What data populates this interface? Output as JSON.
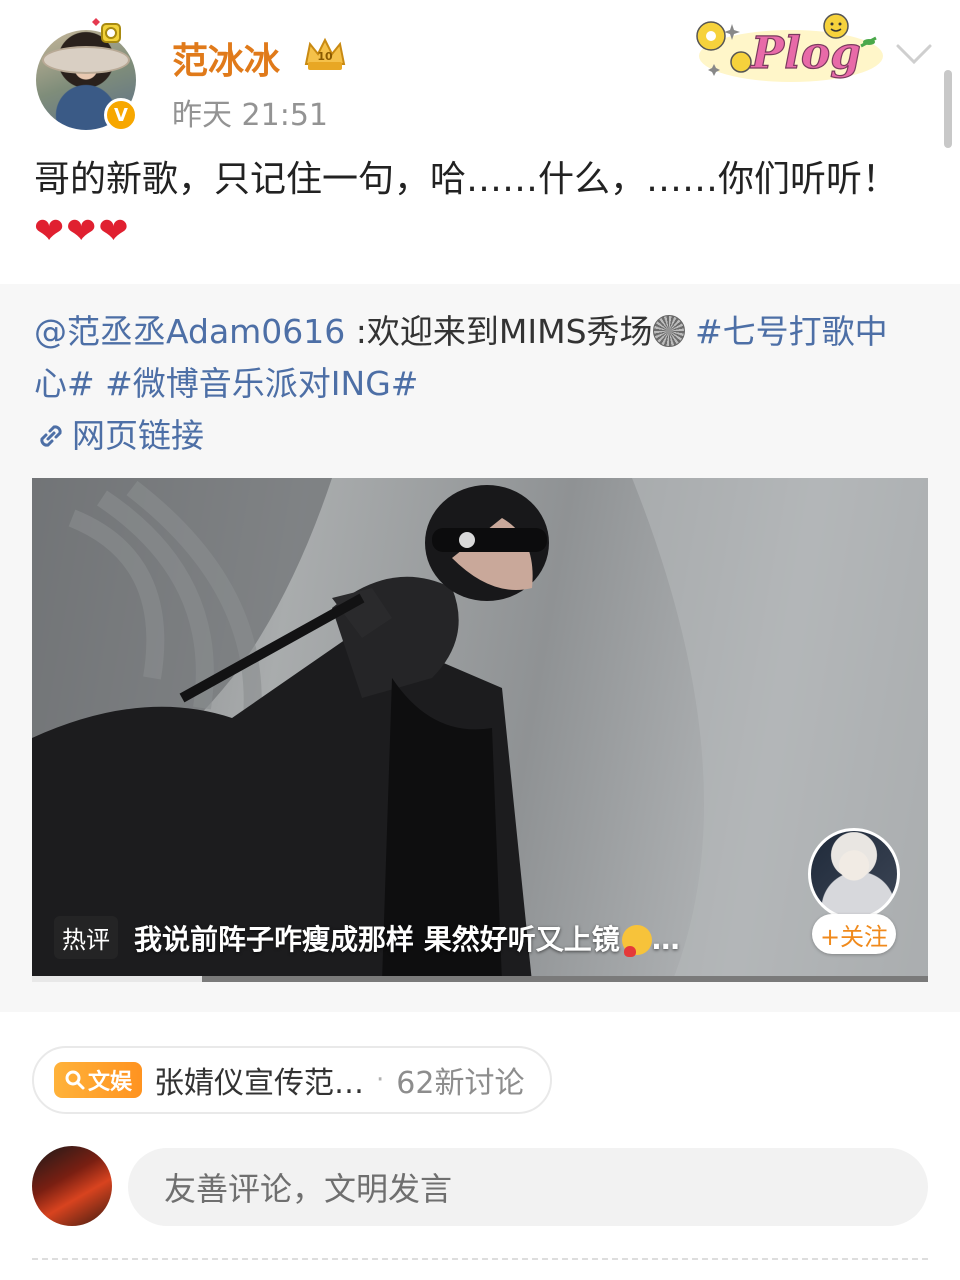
{
  "post": {
    "username": "范冰冰",
    "time": "昨天 21:51",
    "verified_badge": "V",
    "text": "哥的新歌，只记住一句，哈……什么，……你们听听！",
    "hearts": "❤❤❤",
    "sticker_text": "Plog",
    "icons": [
      "verified-icon",
      "crown-badge-icon",
      "chevron-down-icon"
    ]
  },
  "repost": {
    "mention": "@范丞丞Adam0616",
    "text": " :欢迎来到MIMS秀场",
    "hashtags": [
      "#七号打歌中心#",
      "#微博音乐派对ING#"
    ],
    "link_label": "网页链接",
    "video": {
      "hot_badge": "热评",
      "hot_comment": "我说前阵子咋瘦成那样 果然好听又上镜",
      "ellipsis": "…",
      "follow_label": "+关注",
      "progress": 0.19
    }
  },
  "topic": {
    "tag": "文娱",
    "title": "张婧仪宣传范…",
    "dot": "·",
    "count": "62新讨论"
  },
  "comment": {
    "placeholder": "友善评论，文明发言"
  },
  "colors": {
    "username": "#e07a1a",
    "link": "#4d6fa6",
    "verified": "#f7a700",
    "heart": "#e02030"
  }
}
